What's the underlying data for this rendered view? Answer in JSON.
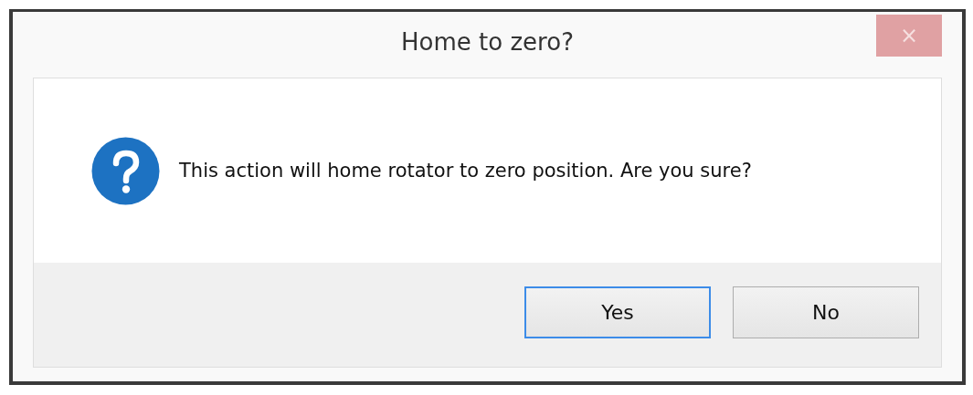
{
  "window": {
    "title": "Home to zero?",
    "close": "×"
  },
  "message": {
    "kind": "question",
    "text": "This action will home rotator to zero position. Are you sure?"
  },
  "buttons": [
    {
      "label": "Yes",
      "focused": true
    },
    {
      "label": "No",
      "focused": false
    }
  ]
}
